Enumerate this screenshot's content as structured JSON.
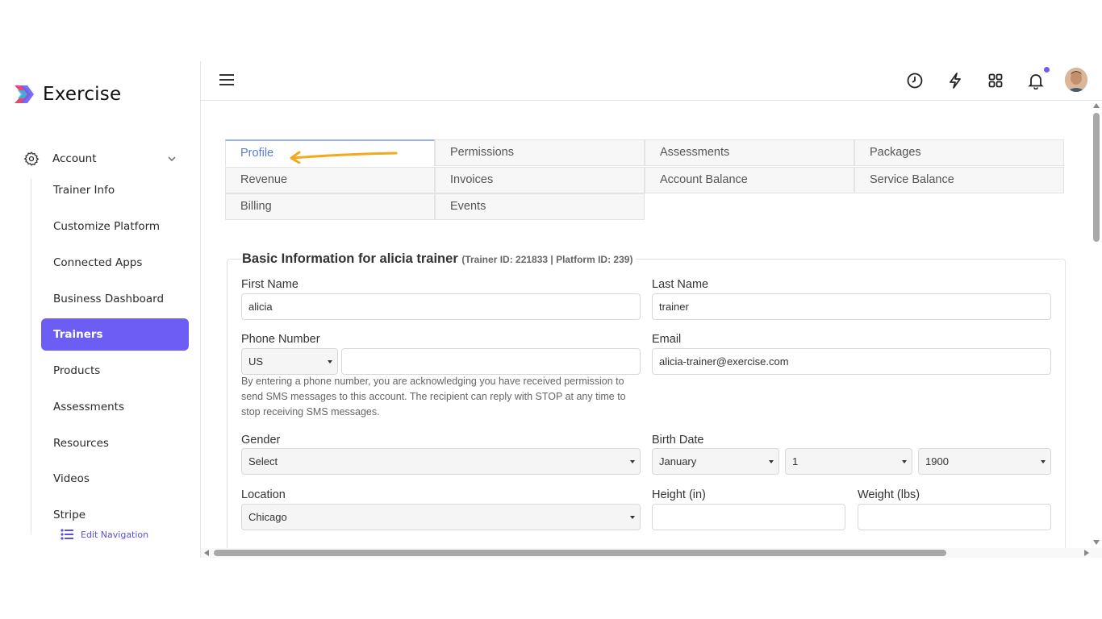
{
  "brand": {
    "name": "Exercise",
    "logo_icon": "exercise-logo-icon"
  },
  "sidebar": {
    "section": {
      "label": "Account",
      "icon": "gear-icon"
    },
    "items": [
      {
        "label": "Trainer Info"
      },
      {
        "label": "Customize Platform"
      },
      {
        "label": "Connected Apps"
      },
      {
        "label": "Business Dashboard"
      },
      {
        "label": "Trainers",
        "active": true
      },
      {
        "label": "Products"
      },
      {
        "label": "Assessments"
      },
      {
        "label": "Resources"
      },
      {
        "label": "Videos"
      },
      {
        "label": "Stripe"
      }
    ],
    "edit_nav_label": "Edit Navigation"
  },
  "header": {
    "icons": [
      "menu-icon",
      "clock-icon",
      "lightning-icon",
      "grid-icon",
      "bell-icon"
    ],
    "accent": "#6c5ef5"
  },
  "tabs": [
    {
      "label": "Profile",
      "active": true
    },
    {
      "label": "Permissions"
    },
    {
      "label": "Assessments"
    },
    {
      "label": "Packages"
    },
    {
      "label": "Revenue"
    },
    {
      "label": "Invoices"
    },
    {
      "label": "Account Balance"
    },
    {
      "label": "Service Balance"
    },
    {
      "label": "Billing"
    },
    {
      "label": "Events"
    }
  ],
  "form": {
    "title": "Basic Information for alicia trainer",
    "subtitle": "(Trainer ID: 221833 | Platform ID: 239)",
    "first_name": {
      "label": "First Name",
      "value": "alicia"
    },
    "last_name": {
      "label": "Last Name",
      "value": "trainer"
    },
    "phone": {
      "label": "Phone Number",
      "country": "US",
      "value": ""
    },
    "email": {
      "label": "Email",
      "value": "alicia-trainer@exercise.com"
    },
    "phone_help": "By entering a phone number, you are acknowledging you have received permission to send SMS messages to this account. The recipient can reply with STOP at any time to stop receiving SMS messages.",
    "gender": {
      "label": "Gender",
      "value": "Select"
    },
    "birth_date": {
      "label": "Birth Date",
      "month": "January",
      "day": "1",
      "year": "1900"
    },
    "location": {
      "label": "Location",
      "value": "Chicago"
    },
    "height": {
      "label": "Height (in)",
      "value": ""
    },
    "weight": {
      "label": "Weight (lbs)",
      "value": ""
    }
  }
}
